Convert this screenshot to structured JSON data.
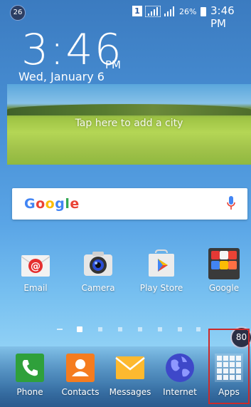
{
  "status_bar": {
    "notification_badge": "26",
    "sim_label": "1",
    "battery_percent": "26%",
    "time": "3:46 PM"
  },
  "lockscreen_clock": {
    "time": "3:46",
    "ampm": "PM",
    "date": "Wed, January 6"
  },
  "weather_widget": {
    "text": "Tap here to add a city"
  },
  "google_search": {
    "logo": "Google"
  },
  "home_apps": [
    {
      "label": "Email"
    },
    {
      "label": "Camera"
    },
    {
      "label": "Play Store"
    },
    {
      "label": "Google"
    }
  ],
  "page_indicator": {
    "pages": 7,
    "active_index": 0
  },
  "floating_badge": "80",
  "dock_apps": [
    {
      "label": "Phone"
    },
    {
      "label": "Contacts"
    },
    {
      "label": "Messages"
    },
    {
      "label": "Internet"
    },
    {
      "label": "Apps"
    }
  ],
  "colors": {
    "highlight": "#cc2a2a",
    "google_blue": "#4285f4",
    "google_red": "#ea4335",
    "google_yellow": "#fbbc05",
    "google_green": "#34a853"
  }
}
